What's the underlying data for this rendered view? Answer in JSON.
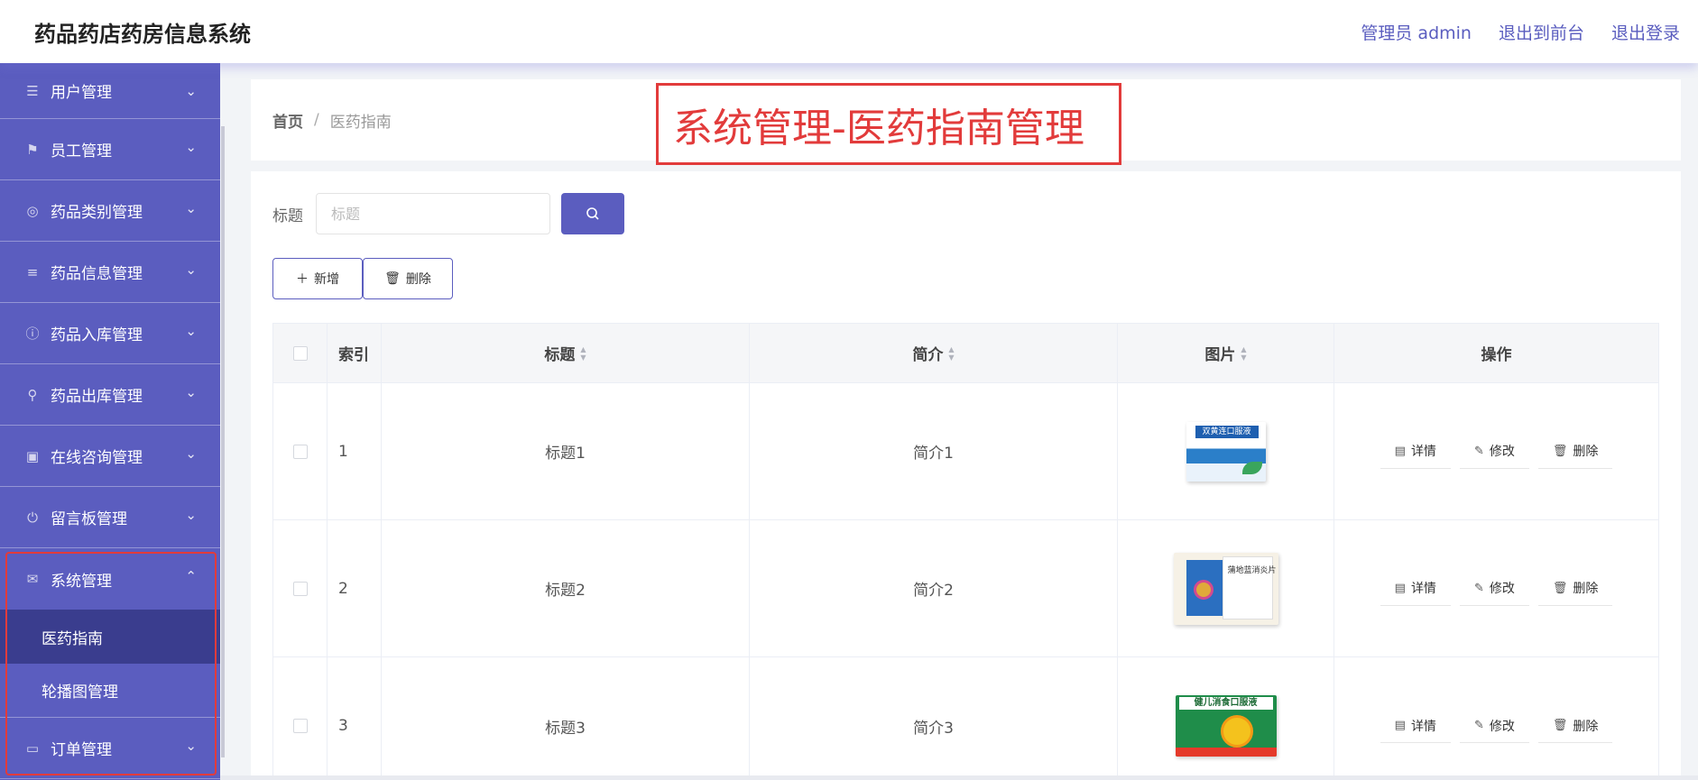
{
  "header": {
    "app_title": "药品药店药房信息系统",
    "admin_label": "管理员 admin",
    "exit_front_label": "退出到前台",
    "logout_label": "退出登录"
  },
  "sidebar": {
    "items": [
      {
        "label": "用户管理",
        "icon": "sliders-icon"
      },
      {
        "label": "员工管理",
        "icon": "flag-icon"
      },
      {
        "label": "药品类别管理",
        "icon": "compass-icon"
      },
      {
        "label": "药品信息管理",
        "icon": "list-icon"
      },
      {
        "label": "药品入库管理",
        "icon": "info-icon"
      },
      {
        "label": "药品出库管理",
        "icon": "user-icon"
      },
      {
        "label": "在线咨询管理",
        "icon": "clipboard-icon"
      },
      {
        "label": "留言板管理",
        "icon": "power-icon"
      },
      {
        "label": "系统管理",
        "icon": "mail-icon"
      },
      {
        "label": "订单管理",
        "icon": "card-icon"
      }
    ],
    "system_submenu": [
      {
        "label": "医药指南",
        "active": true
      },
      {
        "label": "轮播图管理",
        "active": false
      }
    ]
  },
  "breadcrumb": {
    "home": "首页",
    "separator": "/",
    "current": "医药指南"
  },
  "annotation": "系统管理-医药指南管理",
  "search": {
    "label": "标题",
    "placeholder": "标题",
    "value": ""
  },
  "actions": {
    "add_label": "新增",
    "delete_label": "删除"
  },
  "table": {
    "headers": {
      "index": "索引",
      "title": "标题",
      "intro": "简介",
      "image": "图片",
      "ops": "操作"
    },
    "rows": [
      {
        "index": "1",
        "title": "标题1",
        "intro": "简介1",
        "image_label": "双黄连口服液"
      },
      {
        "index": "2",
        "title": "标题2",
        "intro": "简介2",
        "image_label": "蒲地蓝消炎片"
      },
      {
        "index": "3",
        "title": "标题3",
        "intro": "简介3",
        "image_label": "健儿消食口服液"
      }
    ],
    "op_labels": {
      "detail": "详情",
      "edit": "修改",
      "delete": "删除"
    }
  },
  "colors": {
    "primary": "#5b5dbf",
    "sidebar_active": "#3a3d8e",
    "annotation_red": "#e23b3b"
  }
}
